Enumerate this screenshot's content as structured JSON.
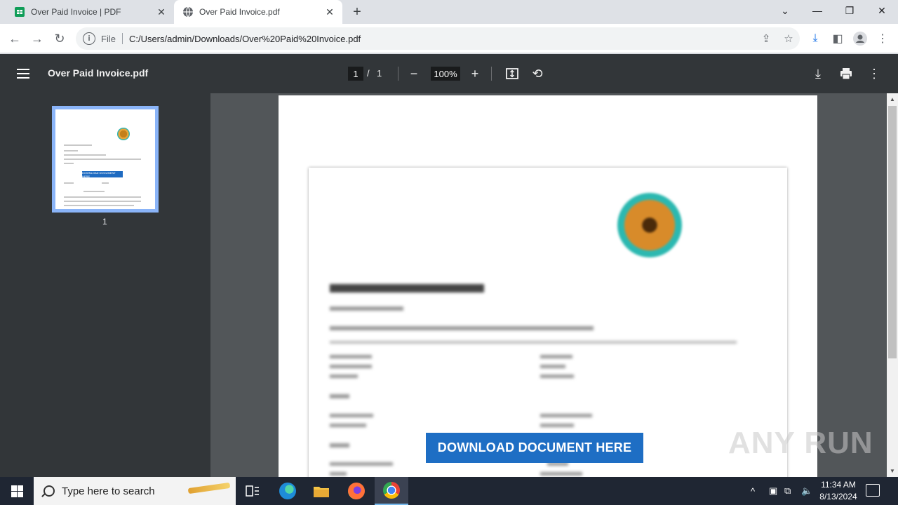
{
  "browser": {
    "tabs": [
      {
        "label": "Over Paid Invoice | PDF",
        "favicon": "sheets-icon",
        "active": false
      },
      {
        "label": "Over Paid Invoice.pdf",
        "favicon": "globe-icon",
        "active": true
      }
    ],
    "address": {
      "scheme": "File",
      "url": "C:/Users/admin/Downloads/Over%20Paid%20Invoice.pdf"
    }
  },
  "pdf_viewer": {
    "title": "Over Paid Invoice.pdf",
    "page_current": "1",
    "page_separator": "/",
    "page_total": "1",
    "zoom": "100%",
    "thumbnail_number": "1"
  },
  "document": {
    "download_button": "DOWNLOAD DOCUMENT HERE",
    "mini_button": "DOWNLOAD DOCUMENT HERE",
    "watermark": "ANY RUN"
  },
  "taskbar": {
    "search_placeholder": "Type here to search",
    "time": "11:34 AM",
    "date": "8/13/2024"
  },
  "colors": {
    "pdf_toolbar": "#323639",
    "viewport": "#525659",
    "download_button": "#1e6ec4",
    "taskbar": "#1f2633"
  }
}
